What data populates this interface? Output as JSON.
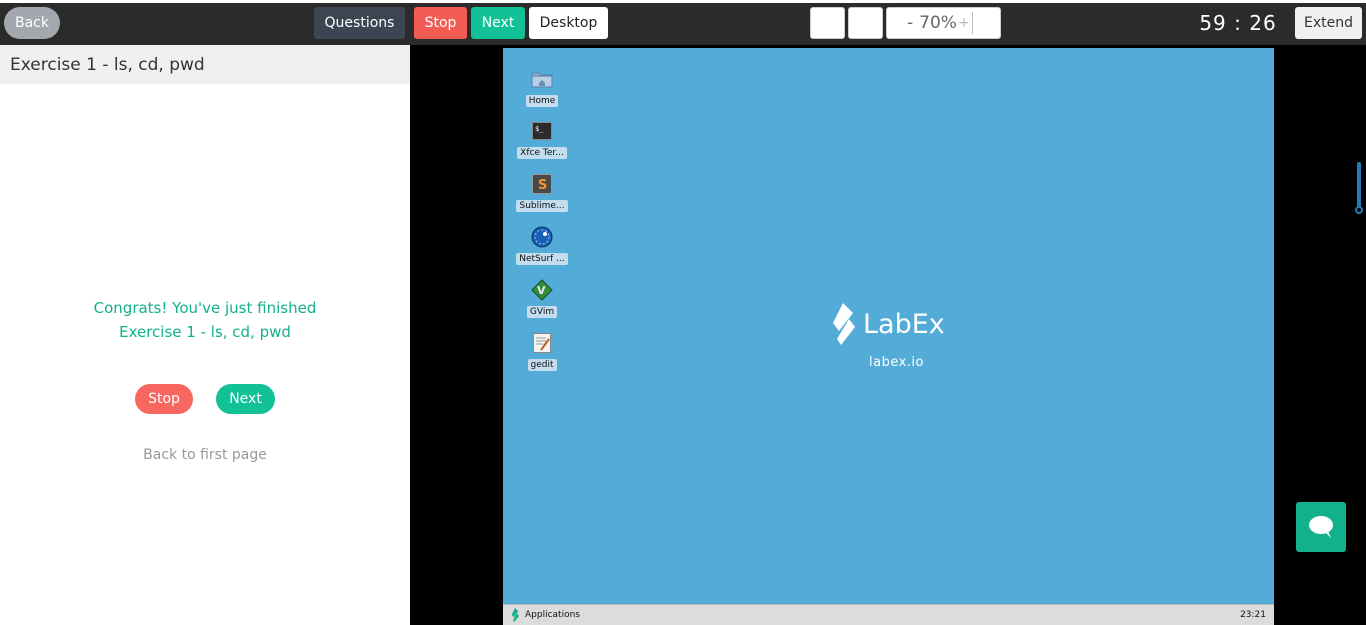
{
  "topbar": {
    "back_label": "Back",
    "questions_label": "Questions",
    "stop_label": "Stop",
    "next_label": "Next",
    "desktop_label": "Desktop",
    "zoom_minus": "-",
    "zoom_value": "70%",
    "zoom_plus": "+",
    "timer": "59 : 26",
    "extend_label": "Extend"
  },
  "left_panel": {
    "exercise_title": "Exercise 1 - ls, cd, pwd",
    "congrats_line1": "Congrats! You've just finished",
    "congrats_line2": "Exercise 1 - ls, cd, pwd",
    "stop_label": "Stop",
    "next_label": "Next",
    "back_first_page": "Back to first page"
  },
  "desktop": {
    "icons": [
      {
        "label": "Home",
        "icon": "folder-home-icon"
      },
      {
        "label": "Xfce Ter...",
        "icon": "terminal-icon"
      },
      {
        "label": "Sublime...",
        "icon": "sublime-text-icon"
      },
      {
        "label": "NetSurf ...",
        "icon": "netsurf-browser-icon"
      },
      {
        "label": "GVim",
        "icon": "gvim-icon"
      },
      {
        "label": "gedit",
        "icon": "gedit-icon"
      }
    ],
    "logo_text": "LabEx",
    "logo_url": "labex.io",
    "taskbar_apps": "Applications",
    "taskbar_clock": "23:21",
    "background_color": "#53acd7"
  },
  "colors": {
    "accent_green": "#12c196",
    "stop_red": "#f25c55"
  }
}
